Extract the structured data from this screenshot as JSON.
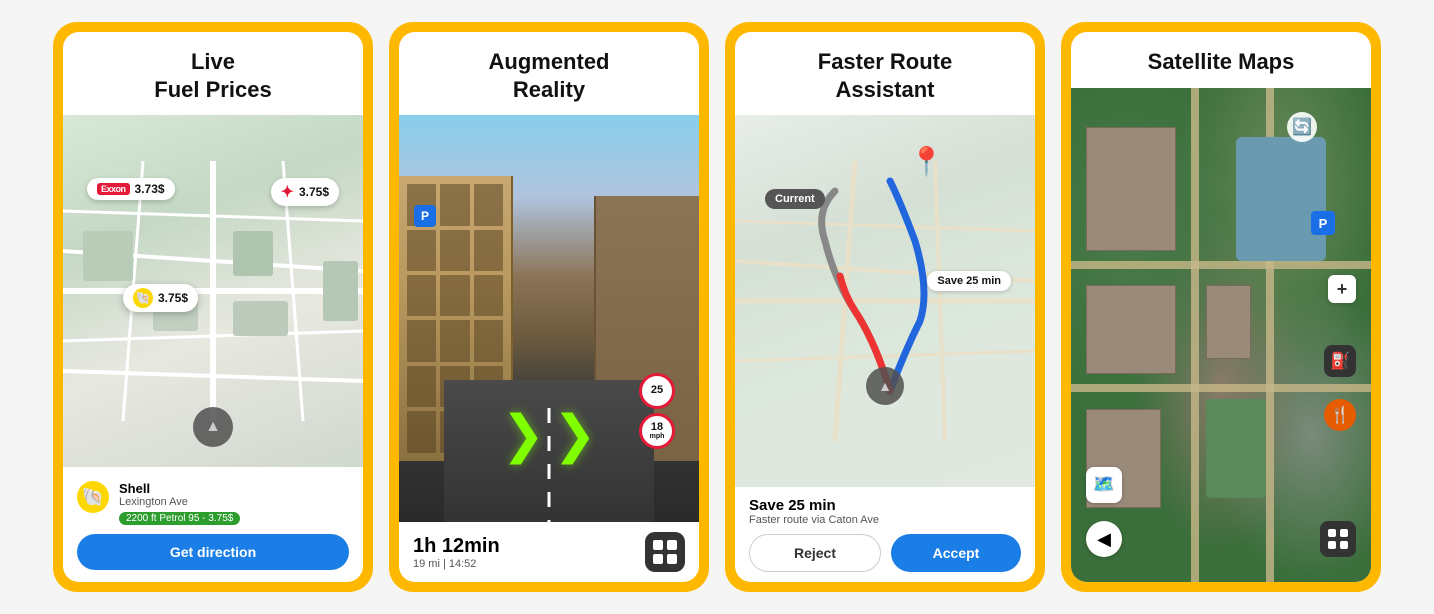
{
  "cards": [
    {
      "id": "live-fuel",
      "title": "Live\nFuel Prices",
      "exxon_price": "3.73$",
      "texaco_price": "3.75$",
      "shell_price": "3.75$",
      "station_name": "Shell",
      "station_address": "Lexington Ave",
      "station_distance": "2200 ft",
      "station_fuel": "Petrol 95 - 3.75$",
      "button_label": "Get direction"
    },
    {
      "id": "augmented",
      "title": "Augmented\nReality",
      "time": "1h 12min",
      "distance_time": "19 mi | 14:52",
      "speed_limit_1": "25",
      "speed_limit_2": "18",
      "speed_unit": "mph"
    },
    {
      "id": "faster-route",
      "title": "Faster Route\nAssistant",
      "current_label": "Current",
      "save_label": "Save 25 min",
      "save_text": "Save 25 min",
      "via_text": "Faster route via Caton Ave",
      "reject_label": "Reject",
      "accept_label": "Accept"
    },
    {
      "id": "satellite",
      "title": "Satellite Maps"
    }
  ]
}
